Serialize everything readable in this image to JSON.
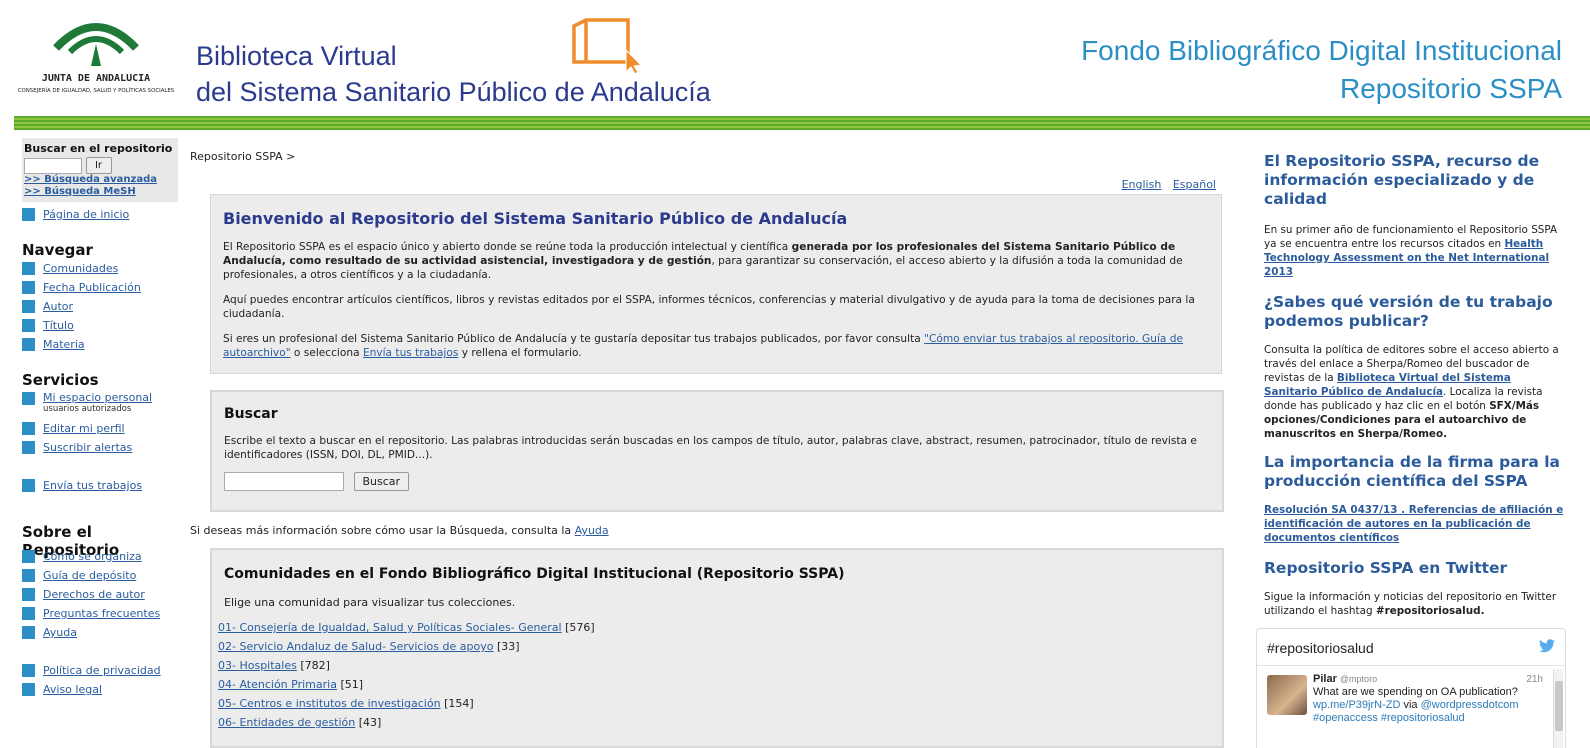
{
  "header": {
    "logo_name": "JUNTA DE ANDALUCIA",
    "logo_sub": "CONSEJERÍA DE IGUALDAD, SALUD Y POLÍTICAS SOCIALES",
    "bv_line1": "Biblioteca Virtual",
    "bv_line2": "del Sistema Sanitario Público de Andalucía",
    "fondo_line1": "Fondo Bibliográfico Digital Institucional",
    "fondo_line2": "Repositorio SSPA"
  },
  "sidebar": {
    "search_title": "Buscar en el repositorio",
    "search_button": "Ir",
    "advanced": ">> Búsqueda avanzada",
    "mesh": ">> Búsqueda MeSH",
    "home": "Página de inicio",
    "nav_heading": "Navegar",
    "nav": [
      "Comunidades",
      "Fecha Publicación",
      "Autor",
      "Título",
      "Materia"
    ],
    "services_heading": "Servicios",
    "my_space": "Mi espacio personal",
    "my_space_sub": "usuarios autorizados",
    "edit_profile": "Editar mi perfil",
    "alerts": "Suscribir alertas",
    "send_works": "Envía tus trabajos",
    "about_heading": "Sobre el Repositorio",
    "about": [
      "Cómo se organiza",
      "Guía de depósito",
      "Derechos de autor",
      "Preguntas frecuentes",
      "Ayuda"
    ],
    "privacy": "Política de privacidad",
    "legal": "Aviso legal"
  },
  "main": {
    "breadcrumb": "Repositorio SSPA >",
    "lang_en": "English",
    "lang_es": "Español",
    "welcome_title": "Bienvenido al Repositorio del Sistema Sanitario Público de Andalucía",
    "p1_a": "El Repositorio SSPA es el espacio único y abierto donde se reúne toda la producción intelectual y científica ",
    "p1_b": "generada por los profesionales del Sistema Sanitario Público de Andalucía, como resultado de su actividad asistencial, investigadora y de gestión",
    "p1_c": ", para garantizar su conservación, el acceso abierto y la difusión a toda la comunidad de profesionales, a otros científicos y a la ciudadanía.",
    "p2": "Aquí puedes encontrar artículos científicos, libros y revistas editados por el SSPA, informes técnicos, conferencias y material divulgativo y de ayuda para la toma de decisiones para la ciudadanía.",
    "p3_a": "Si eres un profesional del Sistema Sanitario Público de Andalucía y te gustaría depositar tus trabajos publicados, por favor consulta ",
    "p3_link1": "\"Cómo enviar tus trabajos al repositorio. Guía de autoarchivo\"",
    "p3_b": " o selecciona ",
    "p3_link2": "Envía tus trabajos",
    "p3_c": " y rellena el formulario.",
    "search_heading": "Buscar",
    "search_text": "Escribe el texto a buscar en el repositorio. Las palabras introducidas serán buscadas en los campos de título, autor, palabras clave, abstract, resumen, patrocinador, título de revista e identificadores (ISSN, DOI, DL, PMID...).",
    "search_button": "Buscar",
    "help_text": "Si deseas más información sobre cómo usar la Búsqueda, consulta la ",
    "help_link": "Ayuda",
    "communities_heading": "Comunidades en el Fondo Bibliográfico Digital Institucional (Repositorio SSPA)",
    "communities_intro": "Elige una comunidad para visualizar tus colecciones.",
    "communities": [
      {
        "name": "01- Consejería de Igualdad, Salud y Políticas Sociales- General",
        "count": "[576]"
      },
      {
        "name": "02- Servicio Andaluz de Salud- Servicios de apoyo",
        "count": "[33]"
      },
      {
        "name": "03- Hospitales",
        "count": "[782]"
      },
      {
        "name": "04- Atención Primaria",
        "count": "[51]"
      },
      {
        "name": "05- Centros e institutos de investigación",
        "count": "[154]"
      },
      {
        "name": "06- Entidades de gestión",
        "count": "[43]"
      }
    ]
  },
  "right": {
    "h1": "El Repositorio SSPA, recurso de información especializado y de calidad",
    "p1": "En su primer año de funcionamiento el Repositorio SSPA ya se encuentra entre los recursos citados en ",
    "p1_link": "Health Technology Assessment on the Net International 2013",
    "h2": "¿Sabes qué versión de tu trabajo podemos publicar?",
    "p2_a": "Consulta la política de editores sobre el acceso abierto a través del enlace a Sherpa/Romeo del buscador de revistas de la ",
    "p2_link": "Biblioteca Virtual del Sistema Sanitario Público de Andalucía",
    "p2_b": ". Localiza la revista donde has publicado y haz clic en el botón ",
    "p2_bold": "SFX/Más opciones/Condiciones para el autoarchivo de manuscritos en Sherpa/Romeo.",
    "h3": "La importancia de la firma para la producción científica del SSPA",
    "p3_link": "Resolución SA 0437/13 . Referencias de afiliación e identificación de autores en la publicación de documentos científicos",
    "h4": "Repositorio SSPA en Twitter",
    "p4_a": "Sigue la información y noticias del repositorio en Twitter utilizando el hashtag ",
    "p4_bold": "#repositoriosalud."
  },
  "twitter": {
    "hashtag": "#repositoriosalud",
    "author": "Pilar",
    "handle": "@mptoro",
    "time": "21h",
    "text": "What are we spending on OA publication?",
    "line2_link": "wp.me/P39jrN-ZD",
    "line2_mid": " via ",
    "line2_link2": "@wordpressdotcom",
    "line3": "#openaccess #repositoriosalud"
  },
  "colors": {
    "title_blue": "#2b3a8c",
    "accent_blue": "#2b8fc6",
    "green": "#5ea82a",
    "orange": "#f08c2c"
  }
}
